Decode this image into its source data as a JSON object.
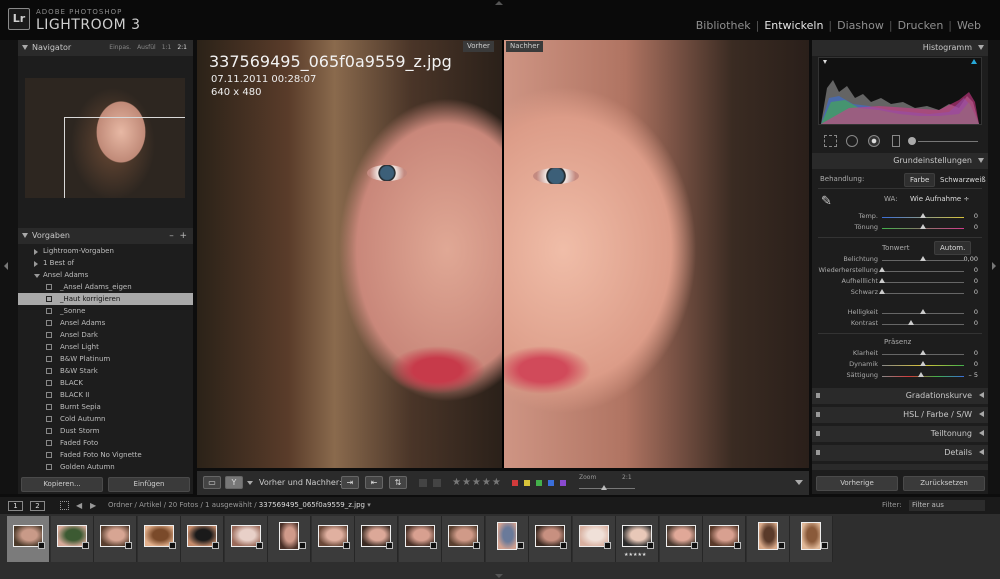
{
  "app": {
    "brand_small": "ADOBE PHOTOSHOP",
    "brand_large": "LIGHTROOM 3",
    "logo": "Lr"
  },
  "modules": [
    "Bibliothek",
    "Entwickeln",
    "Diashow",
    "Drucken",
    "Web"
  ],
  "active_module": "Entwickeln",
  "navigator": {
    "title": "Navigator",
    "options": [
      "Einpas.",
      "Ausfül",
      "1:1",
      "2:1"
    ],
    "selected_option": "2:1"
  },
  "presets": {
    "title": "Vorgaben",
    "add": "+",
    "remove": "–",
    "items": [
      {
        "label": "Lightroom-Vorgaben",
        "type": "folder",
        "open": false
      },
      {
        "label": "1 Best of",
        "type": "folder",
        "open": false
      },
      {
        "label": "Ansel Adams",
        "type": "folder",
        "open": true
      },
      {
        "label": "_Ansel Adams_eigen",
        "type": "item"
      },
      {
        "label": "_Haut korrigieren",
        "type": "item",
        "selected": true
      },
      {
        "label": "_Sonne",
        "type": "item"
      },
      {
        "label": "Ansel Adams",
        "type": "item"
      },
      {
        "label": "Ansel Dark",
        "type": "item"
      },
      {
        "label": "Ansel Light",
        "type": "item"
      },
      {
        "label": "B&W Platinum",
        "type": "item"
      },
      {
        "label": "B&W Stark",
        "type": "item"
      },
      {
        "label": "BLACK",
        "type": "item"
      },
      {
        "label": "BLACK II",
        "type": "item"
      },
      {
        "label": "Burnt Sepia",
        "type": "item"
      },
      {
        "label": "Cold Autumn",
        "type": "item"
      },
      {
        "label": "Dust Storm",
        "type": "item"
      },
      {
        "label": "Faded Foto",
        "type": "item"
      },
      {
        "label": "Faded Foto No Vignette",
        "type": "item"
      },
      {
        "label": "Golden Autumn",
        "type": "item"
      }
    ]
  },
  "left_buttons": {
    "copy": "Kopieren...",
    "paste": "Einfügen"
  },
  "photo": {
    "filename": "337569495_065f0a9559_z.jpg",
    "datetime": "07.11.2011 00:28:07",
    "dimensions": "640 x 480",
    "before_label": "Vorher",
    "after_label": "Nachher"
  },
  "toolbar": {
    "before_after_label": "Vorher und Nachher:",
    "stars": "★★★★★",
    "zoom_label": "Zoom",
    "zoom_value": "2:1",
    "zoom_level": 0.45,
    "color_labels": [
      "#d23b3b",
      "#d9c43a",
      "#43b04a",
      "#3a6ed9",
      "#8a4ad0"
    ]
  },
  "right": {
    "histogram_title": "Histogramm",
    "basic_title": "Grundeinstellungen",
    "treatment_label": "Behandlung:",
    "treatment_color": "Farbe",
    "treatment_bw": "Schwarzweiß",
    "wb_label": "WA:",
    "wb_value": "Wie Aufnahme ÷",
    "temp": {
      "label": "Temp.",
      "value": "0",
      "pos": 0.5
    },
    "tint": {
      "label": "Tönung",
      "value": "0",
      "pos": 0.5
    },
    "tone_label": "Tonwert",
    "auto_label": "Autom.",
    "exposure": {
      "label": "Belichtung",
      "value": "0,00",
      "pos": 0.5
    },
    "recovery": {
      "label": "Wiederherstellung",
      "value": "0",
      "pos": 0.0
    },
    "fill": {
      "label": "Aufhelllicht",
      "value": "0",
      "pos": 0.0
    },
    "blacks": {
      "label": "Schwarz",
      "value": "0",
      "pos": 0.0
    },
    "brightness": {
      "label": "Helligkeit",
      "value": "0",
      "pos": 0.5
    },
    "contrast": {
      "label": "Kontrast",
      "value": "0",
      "pos": 0.35
    },
    "presence_label": "Präsenz",
    "clarity": {
      "label": "Klarheit",
      "value": "0",
      "pos": 0.5
    },
    "vibrance": {
      "label": "Dynamik",
      "value": "0",
      "pos": 0.5
    },
    "saturation": {
      "label": "Sättigung",
      "value": "– 5",
      "pos": 0.47
    },
    "tone_curve_title": "Gradationskurve",
    "hsl_title": "HSL  /  Farbe  /  S/W",
    "split_title": "Teiltonung",
    "detail_title": "Details",
    "prev_btn": "Vorherige",
    "reset_btn": "Zurücksetzen"
  },
  "filmstrip": {
    "view1": "1",
    "view2": "2",
    "breadcrumb_prefix": "Ordner / Artikel / 20 Fotos / 1 ausgewählt / ",
    "breadcrumb_file": "337569495_065f0a9559_z.jpg",
    "filter_label": "Filter:",
    "filter_value": "Filter aus",
    "thumbs": [
      {
        "c1": "#c99a88",
        "c2": "#4b3a2a",
        "orient": "land",
        "selected": true
      },
      {
        "c1": "#3c5a32",
        "c2": "#d5a898",
        "orient": "land"
      },
      {
        "c1": "#d7a593",
        "c2": "#5a4030",
        "orient": "land"
      },
      {
        "c1": "#7a4a2a",
        "c2": "#e3b08c",
        "orient": "land"
      },
      {
        "c1": "#1a1a1a",
        "c2": "#c48a6a",
        "orient": "land"
      },
      {
        "c1": "#e8d0c8",
        "c2": "#9a6a5a",
        "orient": "land"
      },
      {
        "c1": "#d09a8a",
        "c2": "#4a3028",
        "orient": "port"
      },
      {
        "c1": "#e0b0a0",
        "c2": "#6a4838",
        "orient": "land"
      },
      {
        "c1": "#dca898",
        "c2": "#3a2a22",
        "orient": "land"
      },
      {
        "c1": "#d8a090",
        "c2": "#4a3228",
        "orient": "land"
      },
      {
        "c1": "#d09a88",
        "c2": "#5a4030",
        "orient": "land"
      },
      {
        "c1": "#6a7a9a",
        "c2": "#d0a090",
        "orient": "port"
      },
      {
        "c1": "#c89080",
        "c2": "#3a2a22",
        "orient": "land"
      },
      {
        "c1": "#f0e0d8",
        "c2": "#d8b0a0",
        "orient": "land"
      },
      {
        "c1": "#e8c8b8",
        "c2": "#2a2a2a",
        "orient": "land",
        "stars": "★★★★★"
      },
      {
        "c1": "#e0a898",
        "c2": "#4a3a30",
        "orient": "land"
      },
      {
        "c1": "#d8a090",
        "c2": "#5a3a2a",
        "orient": "land"
      },
      {
        "c1": "#5a3a2a",
        "c2": "#d8a888",
        "orient": "port"
      },
      {
        "c1": "#8a5a3a",
        "c2": "#e0b898",
        "orient": "port"
      }
    ]
  }
}
